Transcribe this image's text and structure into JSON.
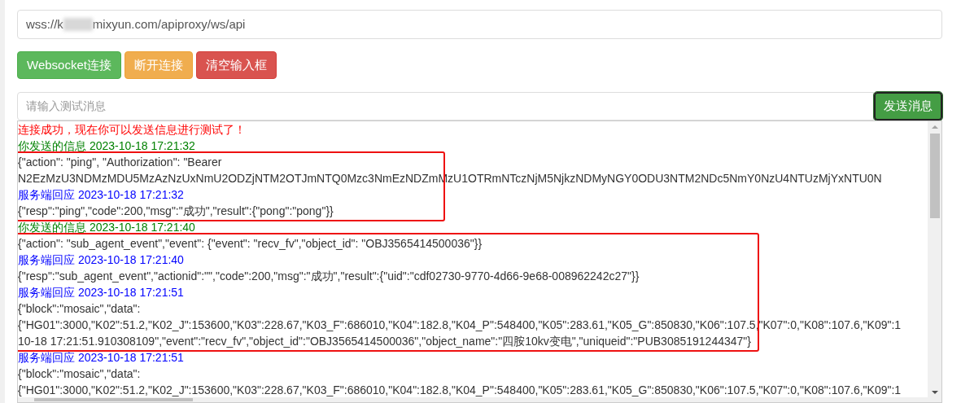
{
  "url_field": {
    "value_start": "wss://k",
    "value_end": "mixyun.com/apiproxy/ws/api"
  },
  "buttons": [
    {
      "label": "Websocket连接",
      "kind": "success"
    },
    {
      "label": "断开连接",
      "kind": "warning"
    },
    {
      "label": "清空输入框",
      "kind": "danger"
    }
  ],
  "message_field": {
    "placeholder": "请输入测试消息"
  },
  "send_button": {
    "label": "发送消息",
    "focused": true
  },
  "log": [
    {
      "highlighted": false,
      "lines": [
        {
          "kind": "notice",
          "text": "连接成功，现在你可以发送信息进行测试了！"
        },
        {
          "kind": "sent_header",
          "text": "你发送的信息 2023-10-18 17:21:32"
        }
      ]
    },
    {
      "highlighted": true,
      "lines": [
        {
          "kind": "data",
          "text": "{\"action\": \"ping\", \"Authorization\": \"Bearer"
        },
        {
          "kind": "data",
          "text": "N2EzMzU3NDMzMDU5MzAzNzUxNmU2ODZjNTM2OTJmNTQ0Mzc3NmEzNDZmMzU1OTRmNTczNjM5NjkzNDMyNGY0ODU3NTM2NDc5NmY0NzU4NTUzMjYxNTU0N"
        },
        {
          "kind": "received_header",
          "text": "服务端回应 2023-10-18 17:21:32"
        },
        {
          "kind": "data",
          "text": "{\"resp\":\"ping\",\"code\":200,\"msg\":\"成功\",\"result\":{\"pong\":\"pong\"}}"
        }
      ]
    },
    {
      "highlighted": false,
      "lines": [
        {
          "kind": "sent_header",
          "text": "你发送的信息 2023-10-18 17:21:40"
        }
      ]
    },
    {
      "highlighted": true,
      "lines": [
        {
          "kind": "data",
          "text": "{\"action\": \"sub_agent_event\",\"event\": {\"event\": \"recv_fv\",\"object_id\": \"OBJ3565414500036\"}}"
        },
        {
          "kind": "received_header",
          "text": "服务端回应 2023-10-18 17:21:40"
        },
        {
          "kind": "data",
          "text": "{\"resp\":\"sub_agent_event\",\"actionid\":\"\",\"code\":200,\"msg\":\"成功\",\"result\":{\"uid\":\"cdf02730-9770-4d66-9e68-008962242c27\"}}"
        },
        {
          "kind": "received_header",
          "text": "服务端回应 2023-10-18 17:21:51"
        },
        {
          "kind": "data",
          "text": "{\"block\":\"mosaic\",\"data\":"
        },
        {
          "kind": "data",
          "text": "{\"HG01\":3000,\"K02\":51.2,\"K02_J\":153600,\"K03\":228.67,\"K03_F\":686010,\"K04\":182.8,\"K04_P\":548400,\"K05\":283.61,\"K05_G\":850830,\"K06\":107.5,\"K07\":0,\"K08\":107.6,\"K09\":1"
        },
        {
          "kind": "data",
          "text": "10-18 17:21:51.910308109\",\"event\":\"recv_fv\",\"object_id\":\"OBJ3565414500036\",\"object_name\":\"四胺10kv变电\",\"uniqueid\":\"PUB3085191244347\"}"
        }
      ]
    },
    {
      "highlighted": false,
      "lines": [
        {
          "kind": "received_header",
          "text": "服务端回应 2023-10-18 17:21:51"
        },
        {
          "kind": "data",
          "text": "{\"block\":\"mosaic\",\"data\":"
        },
        {
          "kind": "data",
          "text": "{\"HG01\":3000,\"K02\":51.2,\"K02_J\":153600,\"K03\":228.67,\"K03_F\":686010,\"K04\":182.8,\"K04_P\":548400,\"K05\":283.61,\"K05_G\":850830,\"K06\":107.5,\"K07\":0,\"K08\":107.6,\"K09\":1"
        }
      ]
    }
  ]
}
